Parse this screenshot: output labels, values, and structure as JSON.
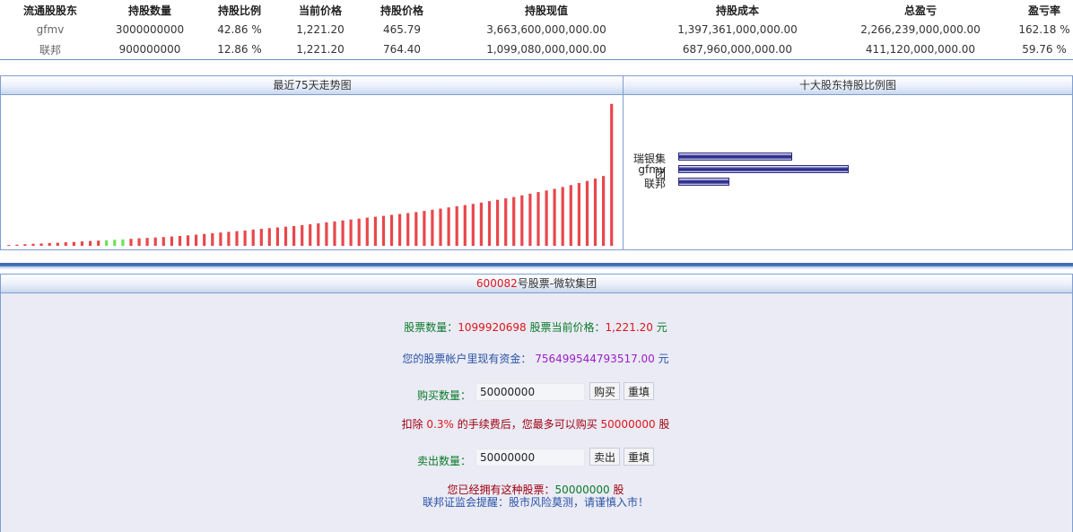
{
  "holders_table": {
    "headers": [
      "流通股股东",
      "持股数量",
      "持股比例",
      "当前价格",
      "持股价格",
      "持股现值",
      "持股成本",
      "总盈亏",
      "盈亏率"
    ],
    "rows": [
      [
        "gfmv",
        "3000000000",
        "42.86 %",
        "1,221.20",
        "465.79",
        "3,663,600,000,000.00",
        "1,397,361,000,000.00",
        "2,266,239,000,000.00",
        "162.18 %"
      ],
      [
        "联邦",
        "900000000",
        "12.86 %",
        "1,221.20",
        "764.40",
        "1,099,080,000,000.00",
        "687,960,000,000.00",
        "411,120,000,000.00",
        "59.76 %"
      ]
    ]
  },
  "trend_panel": {
    "title": "最近75天走势图"
  },
  "holding_panel": {
    "title": "十大股东持股比例图"
  },
  "chart_data": [
    {
      "type": "bar",
      "title": "最近75天走势图",
      "xlabel": "",
      "ylabel": "",
      "ylim": [
        0,
        1250
      ],
      "grid": false,
      "colors": {
        "up": "#e8474c",
        "down": "#6ce05a"
      },
      "values": [
        8,
        10,
        14,
        18,
        20,
        24,
        27,
        30,
        33,
        38,
        42,
        45,
        48,
        52,
        55,
        60,
        65,
        68,
        72,
        76,
        80,
        85,
        90,
        96,
        102,
        108,
        114,
        120,
        126,
        132,
        140,
        146,
        152,
        158,
        164,
        170,
        178,
        186,
        194,
        202,
        210,
        218,
        226,
        234,
        242,
        250,
        258,
        266,
        274,
        282,
        290,
        300,
        310,
        320,
        330,
        340,
        350,
        360,
        372,
        384,
        396,
        408,
        420,
        434,
        448,
        462,
        476,
        490,
        506,
        522,
        540,
        558,
        578,
        600,
        1221
      ],
      "directions": [
        "up",
        "up",
        "up",
        "up",
        "up",
        "up",
        "up",
        "up",
        "up",
        "up",
        "up",
        "up",
        "down",
        "down",
        "down",
        "up",
        "up",
        "up",
        "up",
        "up",
        "up",
        "up",
        "up",
        "up",
        "up",
        "up",
        "up",
        "up",
        "up",
        "up",
        "up",
        "up",
        "up",
        "up",
        "up",
        "up",
        "up",
        "up",
        "up",
        "up",
        "up",
        "up",
        "up",
        "up",
        "up",
        "up",
        "up",
        "up",
        "up",
        "up",
        "up",
        "up",
        "up",
        "up",
        "up",
        "up",
        "up",
        "up",
        "up",
        "up",
        "up",
        "up",
        "up",
        "up",
        "up",
        "up",
        "up",
        "up",
        "up",
        "up",
        "up",
        "up",
        "up",
        "up",
        "up"
      ]
    },
    {
      "type": "bar",
      "title": "十大股东持股比例图",
      "categories": [
        "瑞银集团",
        "gfmv",
        "联邦"
      ],
      "values": [
        28.57,
        42.86,
        12.86
      ]
    }
  ],
  "trade": {
    "stock_code": "600082",
    "stock_title_suffix": "号股票-微软集团",
    "qty_label": "股票数量：",
    "qty_value": "1099920698",
    "price_label": " 股票当前价格：",
    "price_value": "1,221.20",
    "price_unit": " 元",
    "funds_label": "您的股票帐户里现有资金：",
    "funds_value": "756499544793517.00",
    "funds_unit": " 元",
    "buy_label": "购买数量：",
    "buy_input_value": "50000000",
    "buy_button": "购买",
    "reset_button": "重填",
    "fee_prefix": "扣除 ",
    "fee_value": "0.3%",
    "fee_mid": " 的手续费后，您最多可以购买 ",
    "fee_max": "50000000",
    "fee_suffix": " 股",
    "sell_label": "卖出数量：",
    "sell_input_value": "50000000",
    "sell_button": "卖出",
    "reset_button_2": "重填",
    "own_label": "您已经拥有这种股票：",
    "own_value": "50000000",
    "own_unit": " 股",
    "warning": "联邦证监会提醒：股市风险莫测，请谨慎入市！"
  }
}
